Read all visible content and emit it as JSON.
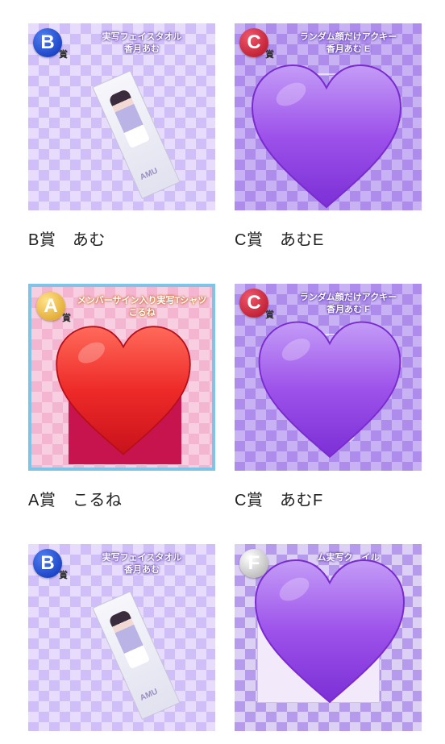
{
  "items": [
    {
      "badge": "B",
      "badge_suffix": "賞",
      "product_title": "実写フェイスタオル",
      "product_subtitle": "香月あむ",
      "towel_logo": "AMU",
      "label": "B賞　あむ",
      "overlay": "none"
    },
    {
      "badge": "C",
      "badge_suffix": "賞",
      "product_title": "ランダム顔だけアクキー",
      "product_subtitle": "香月あむ E",
      "label": "C賞　あむE",
      "overlay": "purple-heart"
    },
    {
      "badge": "A",
      "badge_suffix": "賞",
      "product_title": "メンバーサイン入り実写Tシャツ",
      "product_subtitle": "こるね",
      "label": "A賞　こるね",
      "overlay": "red-heart"
    },
    {
      "badge": "C",
      "badge_suffix": "賞",
      "product_title": "ランダム顔だけアクキー",
      "product_subtitle": "香月あむ F",
      "label": "C賞　あむF",
      "overlay": "purple-heart"
    },
    {
      "badge": "B",
      "badge_suffix": "賞",
      "product_title": "実写フェイスタオル",
      "product_subtitle": "香月あむ",
      "towel_logo": "AMU",
      "label": "",
      "overlay": "none"
    },
    {
      "badge": "F",
      "badge_suffix": "",
      "product_title": "ム実写ク　イル",
      "product_subtitle": "",
      "label": "",
      "overlay": "purple-heart"
    }
  ],
  "colors": {
    "heart_purple": "#9b4de6",
    "heart_red": "#e8202a",
    "selected_border": "#7cc4e8"
  }
}
